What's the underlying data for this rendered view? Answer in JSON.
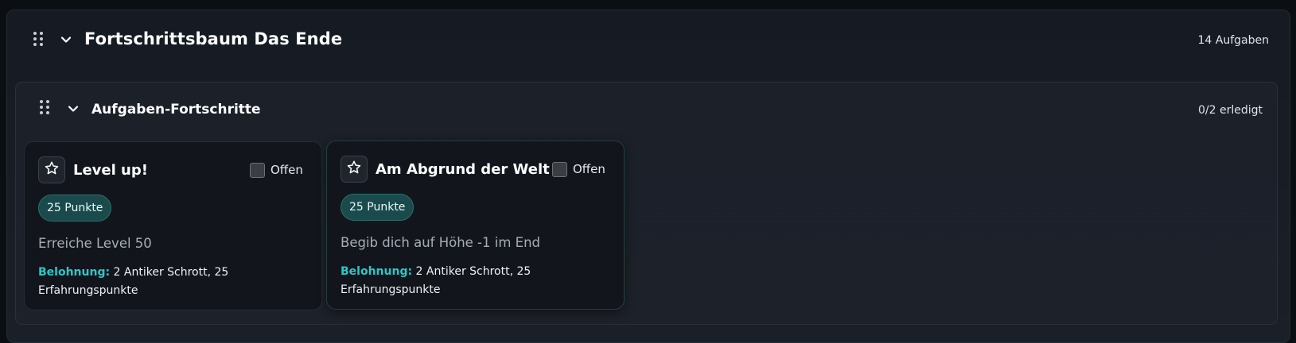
{
  "outer": {
    "title": "Fortschrittsbaum Das Ende",
    "count": "14 Aufgaben"
  },
  "inner": {
    "title": "Aufgaben-Fortschritte",
    "count": "0/2 erledigt"
  },
  "cards": [
    {
      "title": "Level up!",
      "status": "Offen",
      "points": "25 Punkte",
      "description": "Erreiche Level 50",
      "reward_label": "Belohnung:",
      "reward_text": "2 Antiker Schrott, 25 Erfahrungspunkte"
    },
    {
      "title": "Am Abgrund der Welt",
      "status": "Offen",
      "points": "25 Punkte",
      "description": "Begib dich auf Höhe -1 im End",
      "reward_label": "Belohnung:",
      "reward_text": "2 Antiker Schrott, 25 Erfahrungspunkte"
    }
  ],
  "icons": {
    "drag": "drag-handle-icon",
    "chevron": "chevron-down-icon",
    "star": "star-icon"
  },
  "colors": {
    "accent": "#2bc7c9",
    "badge_bg": "#1a4a4c"
  }
}
